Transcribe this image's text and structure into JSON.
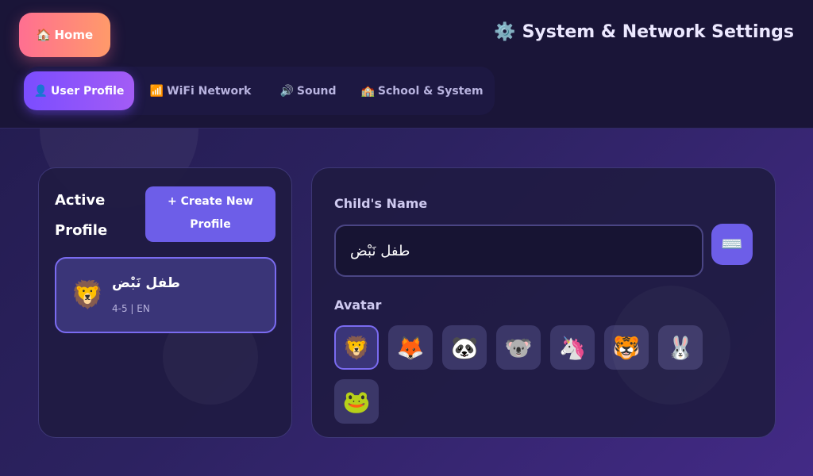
{
  "header": {
    "home_label": "Home",
    "home_icon": "🏠",
    "title": "System & Network Settings",
    "title_icon": "⚙️"
  },
  "tabs": [
    {
      "icon": "👤",
      "label": "User Profile",
      "active": true
    },
    {
      "icon": "📶",
      "label": "WiFi Network",
      "active": false
    },
    {
      "icon": "🔊",
      "label": "Sound",
      "active": false
    },
    {
      "icon": "🏫",
      "label": "School & System",
      "active": false
    }
  ],
  "profiles_panel": {
    "title_line1": "Active",
    "title_line2": "Profile",
    "create_line1": "+ Create New",
    "create_line2": "Profile",
    "profile": {
      "avatar": "🦁",
      "name": "طفل نَبْض",
      "meta": "4-5 | EN"
    }
  },
  "edit_panel": {
    "name_label": "Child's Name",
    "name_value": "طفل نَبْض",
    "keyboard_icon": "⌨️",
    "avatar_label": "Avatar",
    "avatars": [
      "🦁",
      "🦊",
      "🐼",
      "🐨",
      "🦄",
      "🐯",
      "🐰",
      "🐸"
    ],
    "selected_avatar": 0
  }
}
